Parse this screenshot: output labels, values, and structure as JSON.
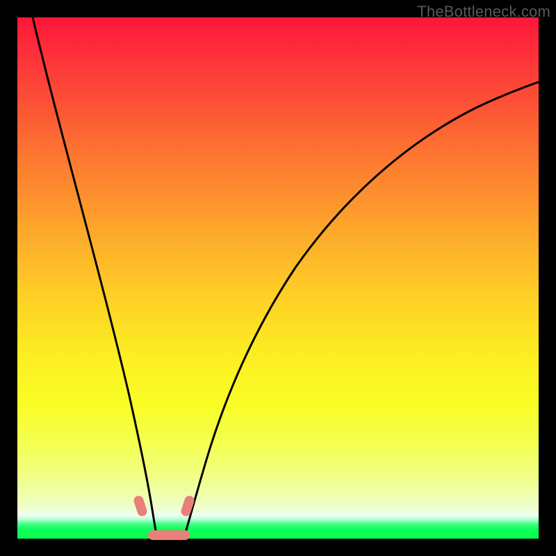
{
  "watermark": "TheBottleneck.com",
  "colors": {
    "curve_stroke": "#000000",
    "marker_fill": "#e9807a",
    "frame": "#000000"
  },
  "chart_data": {
    "type": "line",
    "title": "",
    "xlabel": "",
    "ylabel": "",
    "xlim": [
      0,
      100
    ],
    "ylim": [
      0,
      100
    ],
    "series": [
      {
        "name": "left-arm",
        "x": [
          3,
          5,
          8,
          11,
          14,
          17,
          20,
          22,
          23.5,
          24.5,
          25.2,
          25.8
        ],
        "y": [
          100,
          90,
          78,
          64,
          50,
          36,
          22,
          12,
          6,
          3,
          1.2,
          0.4
        ]
      },
      {
        "name": "right-arm",
        "x": [
          30.5,
          31.5,
          33,
          35,
          38,
          42,
          48,
          56,
          66,
          78,
          90,
          100
        ],
        "y": [
          0.4,
          1.4,
          3.5,
          7,
          13,
          22,
          34,
          48,
          62,
          74,
          83,
          88
        ]
      },
      {
        "name": "valley-floor",
        "x": [
          25.8,
          27,
          28.2,
          29.4,
          30.5
        ],
        "y": [
          0.4,
          0.1,
          0.05,
          0.1,
          0.4
        ]
      }
    ],
    "heatmap_gradient_stops": [
      {
        "t": 0.0,
        "color": "#fb1639"
      },
      {
        "t": 0.27,
        "color": "#fd7830"
      },
      {
        "t": 0.53,
        "color": "#fece26"
      },
      {
        "t": 0.74,
        "color": "#f9fd24"
      },
      {
        "t": 0.95,
        "color": "#eeffc4"
      },
      {
        "t": 1.0,
        "color": "#07fe4e"
      }
    ],
    "markers": [
      {
        "name": "left-tick-upper",
        "cx": 23.4,
        "cy": 4.2,
        "orient": "vertical-tilt"
      },
      {
        "name": "right-tick-upper",
        "cx": 32.9,
        "cy": 4.2,
        "orient": "vertical-tilt"
      },
      {
        "name": "valley-floor-bar",
        "cx": 28.0,
        "cy": 0.5,
        "orient": "horizontal"
      }
    ]
  }
}
